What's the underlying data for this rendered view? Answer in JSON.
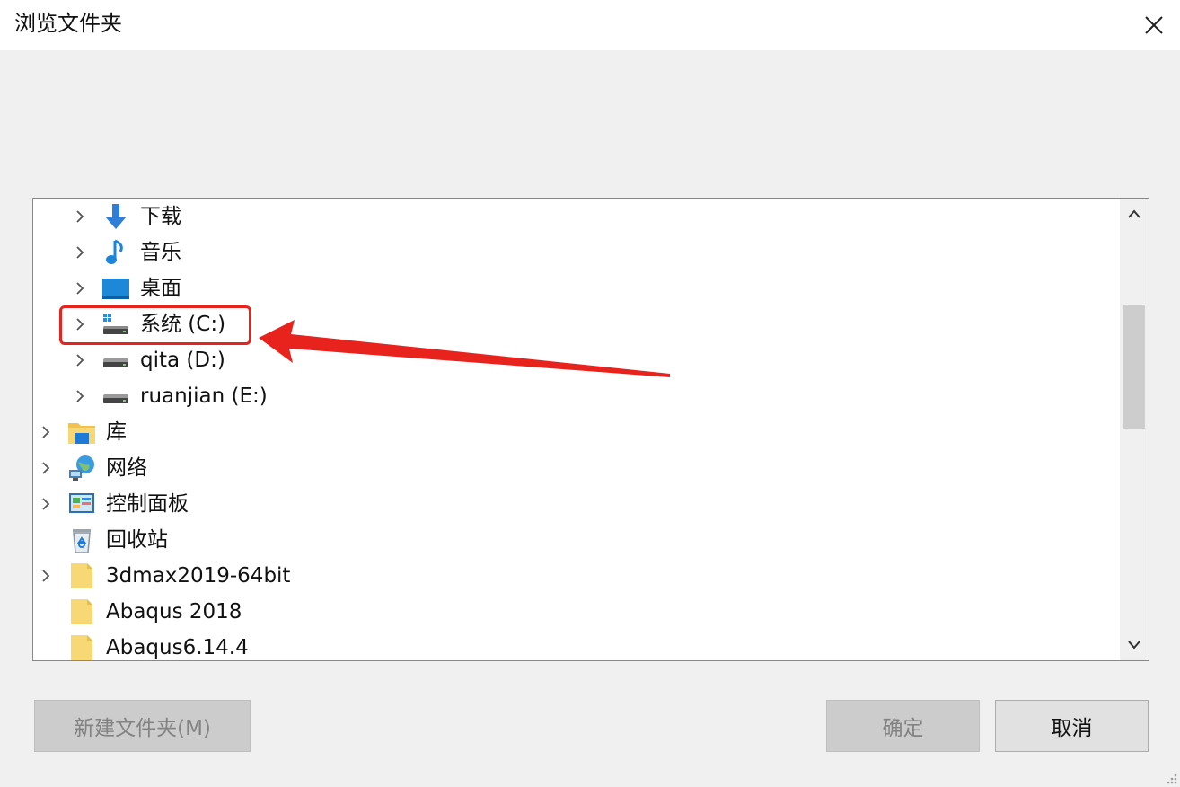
{
  "dialog": {
    "title": "浏览文件夹"
  },
  "tree": {
    "items": [
      {
        "label": "下载",
        "icon": "download-icon",
        "has_children": true
      },
      {
        "label": "音乐",
        "icon": "music-icon",
        "has_children": true
      },
      {
        "label": "桌面",
        "icon": "desktop-icon",
        "has_children": true
      },
      {
        "label": "系统 (C:)",
        "icon": "system-drive-icon",
        "has_children": true
      },
      {
        "label": "qita (D:)",
        "icon": "drive-icon",
        "has_children": true
      },
      {
        "label": "ruanjian (E:)",
        "icon": "drive-icon",
        "has_children": true
      },
      {
        "label": "库",
        "icon": "library-icon",
        "has_children": true
      },
      {
        "label": "网络",
        "icon": "network-icon",
        "has_children": true
      },
      {
        "label": "控制面板",
        "icon": "control-panel-icon",
        "has_children": true
      },
      {
        "label": "回收站",
        "icon": "recycle-bin-icon",
        "has_children": false
      },
      {
        "label": "3dmax2019-64bit",
        "icon": "folder-icon",
        "has_children": true
      },
      {
        "label": "Abaqus 2018",
        "icon": "folder-icon",
        "has_children": false
      },
      {
        "label": "Abaqus6.14.4",
        "icon": "folder-icon",
        "has_children": false
      }
    ]
  },
  "buttons": {
    "new_folder": "新建文件夹(M)",
    "ok": "确定",
    "cancel": "取消"
  },
  "colors": {
    "annotation": "#e8231d",
    "folder": "#f8d775",
    "accent": "#1e7ad6"
  }
}
